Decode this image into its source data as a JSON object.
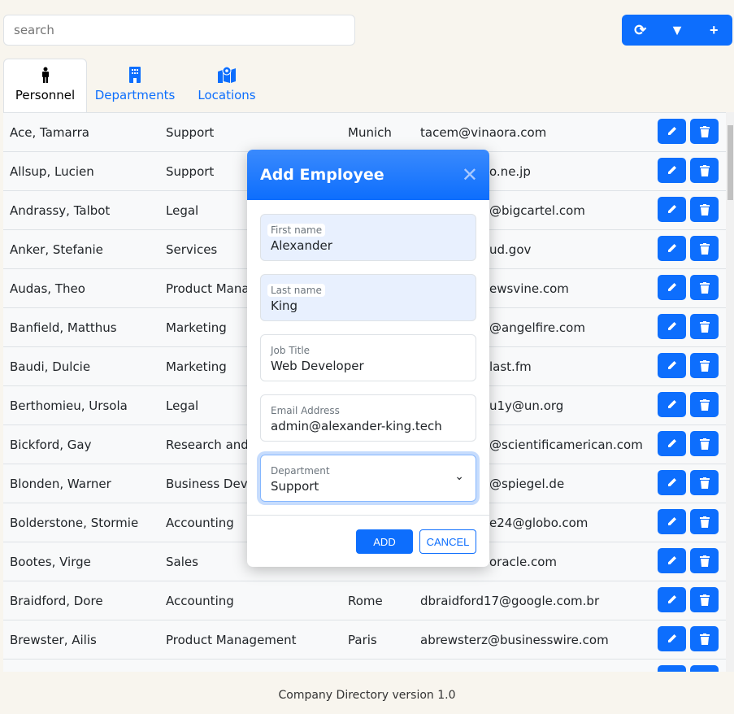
{
  "search": {
    "placeholder": "search"
  },
  "toolbar": {
    "icons": [
      "refresh-icon",
      "filter-icon",
      "plus-icon"
    ]
  },
  "tabs": [
    {
      "label": "Personnel",
      "icon": "person-icon",
      "active": true
    },
    {
      "label": "Departments",
      "icon": "building-icon"
    },
    {
      "label": "Locations",
      "icon": "map-location-icon"
    }
  ],
  "rows": [
    {
      "name": "Ace, Tamarra",
      "department": "Support",
      "location": "Munich",
      "email": "tacem@vinaora.com"
    },
    {
      "name": "Allsup, Lucien",
      "department": "Support",
      "location": "",
      "email": "o.ne.jp"
    },
    {
      "name": "Andrassy, Talbot",
      "department": "Legal",
      "location": "",
      "email": "@bigcartel.com"
    },
    {
      "name": "Anker, Stefanie",
      "department": "Services",
      "location": "",
      "email": "ud.gov"
    },
    {
      "name": "Audas, Theo",
      "department": "Product Mana",
      "location": "",
      "email": "ewsvine.com"
    },
    {
      "name": "Banfield, Matthus",
      "department": "Marketing",
      "location": "",
      "email": "@angelfire.com"
    },
    {
      "name": "Baudi, Dulcie",
      "department": "Marketing",
      "location": "",
      "email": "last.fm"
    },
    {
      "name": "Berthomieu, Ursola",
      "department": "Legal",
      "location": "",
      "email": "u1y@un.org"
    },
    {
      "name": "Bickford, Gay",
      "department": "Research and",
      "location": "",
      "email": "@scientificamerican.com"
    },
    {
      "name": "Blonden, Warner",
      "department": "Business Deve",
      "location": "",
      "email": "@spiegel.de"
    },
    {
      "name": "Bolderstone, Stormie",
      "department": "Accounting",
      "location": "",
      "email": "e24@globo.com"
    },
    {
      "name": "Bootes, Virge",
      "department": "Sales",
      "location": "",
      "email": "oracle.com"
    },
    {
      "name": "Braidford, Dore",
      "department": "Accounting",
      "location": "Rome",
      "email": "dbraidford17@google.com.br"
    },
    {
      "name": "Brewster, Ailis",
      "department": "Product Management",
      "location": "Paris",
      "email": "abrewsterz@businesswire.com"
    },
    {
      "name": "",
      "department": "",
      "location": "",
      "email": ""
    }
  ],
  "modal": {
    "title": "Add Employee",
    "fields": [
      {
        "label": "First name",
        "value": "Alexander"
      },
      {
        "label": "Last name",
        "value": "King"
      },
      {
        "label": "Job Title",
        "value": "Web Developer"
      },
      {
        "label": "Email Address",
        "value": "admin@alexander-king.tech"
      },
      {
        "label": "Department",
        "value": "Support"
      }
    ],
    "add_label": "ADD",
    "cancel_label": "CANCEL"
  },
  "footer": "Company Directory version 1.0",
  "colors": {
    "accent": "#0d6efd",
    "background": "#f8f5ee"
  }
}
